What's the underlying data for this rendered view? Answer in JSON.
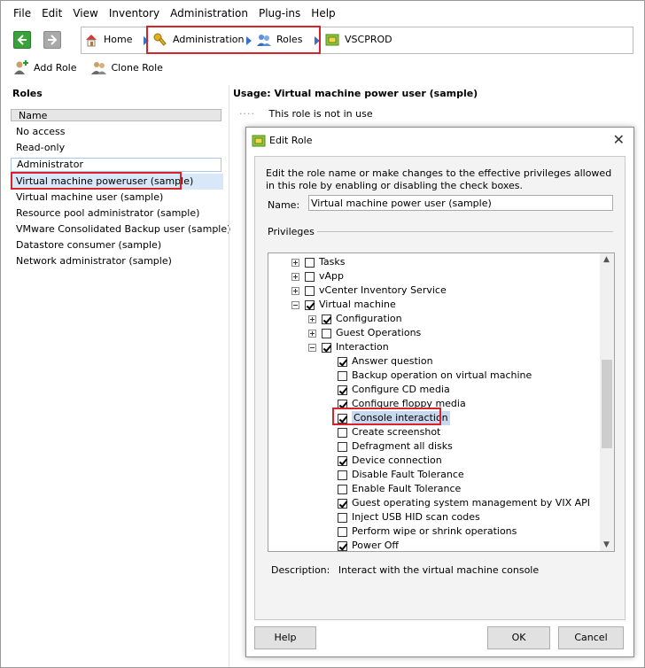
{
  "menu": [
    "File",
    "Edit",
    "View",
    "Inventory",
    "Administration",
    "Plug-ins",
    "Help"
  ],
  "breadcrumb": {
    "home": "Home",
    "administration": "Administration",
    "roles": "Roles",
    "server": "VSCPROD"
  },
  "toolbar": {
    "add_role": "Add Role",
    "clone_role": "Clone Role"
  },
  "left_pane": {
    "title": "Roles",
    "column_header": "Name",
    "roles": [
      "No access",
      "Read-only",
      "Administrator",
      "Virtual machine poweruser (sample)",
      "Virtual machine user (sample)",
      "Resource pool administrator (sample)",
      "VMware Consolidated Backup user (sample)",
      "Datastore consumer (sample)",
      "Network administrator (sample)"
    ]
  },
  "right_pane": {
    "usage_title": "Usage: Virtual machine power user (sample)",
    "usage_text": "This role is not in use"
  },
  "dialog": {
    "title": "Edit Role",
    "instructions": "Edit the role name or make changes to the effective privileges allowed in this role by enabling or disabling the check boxes.",
    "name_label": "Name:",
    "name_value": "Virtual machine power user (sample)",
    "privileges_label": "Privileges",
    "tree": [
      {
        "label": "Tasks",
        "checked": false
      },
      {
        "label": "vApp",
        "checked": false
      },
      {
        "label": "vCenter Inventory Service",
        "checked": false
      },
      {
        "label": "Virtual machine",
        "checked": true
      },
      {
        "label": "Configuration",
        "checked": true
      },
      {
        "label": "Guest Operations",
        "checked": false
      },
      {
        "label": "Interaction",
        "checked": true
      },
      {
        "label": "Answer question",
        "checked": true
      },
      {
        "label": "Backup operation on virtual machine",
        "checked": false
      },
      {
        "label": "Configure CD media",
        "checked": true
      },
      {
        "label": "Configure floppy media",
        "checked": true
      },
      {
        "label": "Console interaction",
        "checked": true
      },
      {
        "label": "Create screenshot",
        "checked": false
      },
      {
        "label": "Defragment all disks",
        "checked": false
      },
      {
        "label": "Device connection",
        "checked": true
      },
      {
        "label": "Disable Fault Tolerance",
        "checked": false
      },
      {
        "label": "Enable Fault Tolerance",
        "checked": false
      },
      {
        "label": "Guest operating system management by VIX API",
        "checked": true
      },
      {
        "label": "Inject USB HID scan codes",
        "checked": false
      },
      {
        "label": "Perform wipe or shrink operations",
        "checked": false
      },
      {
        "label": "Power Off",
        "checked": true
      }
    ],
    "description_label": "Description:",
    "description_text": "Interact with the virtual machine console",
    "buttons": {
      "help": "Help",
      "ok": "OK",
      "cancel": "Cancel"
    }
  },
  "colors": {
    "highlight_red": "#d9232b",
    "selection": "#d9e8f9",
    "breadcrumb_arrow": "#3872c8"
  }
}
